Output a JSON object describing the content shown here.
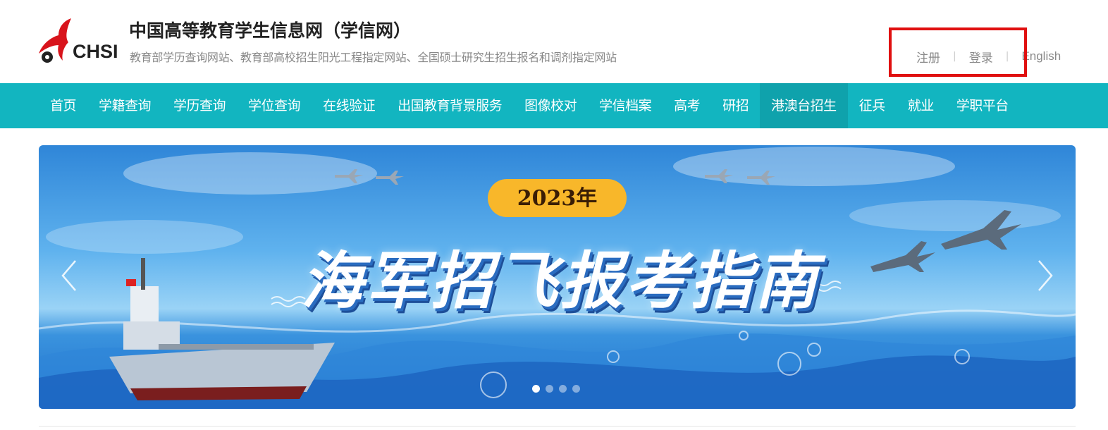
{
  "header": {
    "logo_text": "CHSI",
    "title": "中国高等教育学生信息网（学信网）",
    "subtitle": "教育部学历查询网站、教育部高校招生阳光工程指定网站、全国硕士研究生招生报名和调剂指定网站",
    "links": {
      "register": "注册",
      "login": "登录",
      "english": "English",
      "separator": "|"
    }
  },
  "nav": {
    "items": [
      {
        "label": "首页"
      },
      {
        "label": "学籍查询"
      },
      {
        "label": "学历查询"
      },
      {
        "label": "学位查询"
      },
      {
        "label": "在线验证"
      },
      {
        "label": "出国教育背景服务"
      },
      {
        "label": "图像校对"
      },
      {
        "label": "学信档案"
      },
      {
        "label": "高考"
      },
      {
        "label": "研招"
      },
      {
        "label": "港澳台招生"
      },
      {
        "label": "征兵"
      },
      {
        "label": "就业"
      },
      {
        "label": "学职平台"
      }
    ],
    "active_index": 10
  },
  "banner": {
    "year_badge": "2023年",
    "headline": "海军招飞报考指南",
    "slide_count": 4,
    "active_slide": 0,
    "icons": {
      "prev": "chevron-left-icon",
      "next": "chevron-right-icon"
    }
  },
  "colors": {
    "nav_bg": "#12b5c0",
    "nav_active": "#0fa2ac",
    "highlight": "#e01010",
    "badge": "#f8b72a"
  }
}
